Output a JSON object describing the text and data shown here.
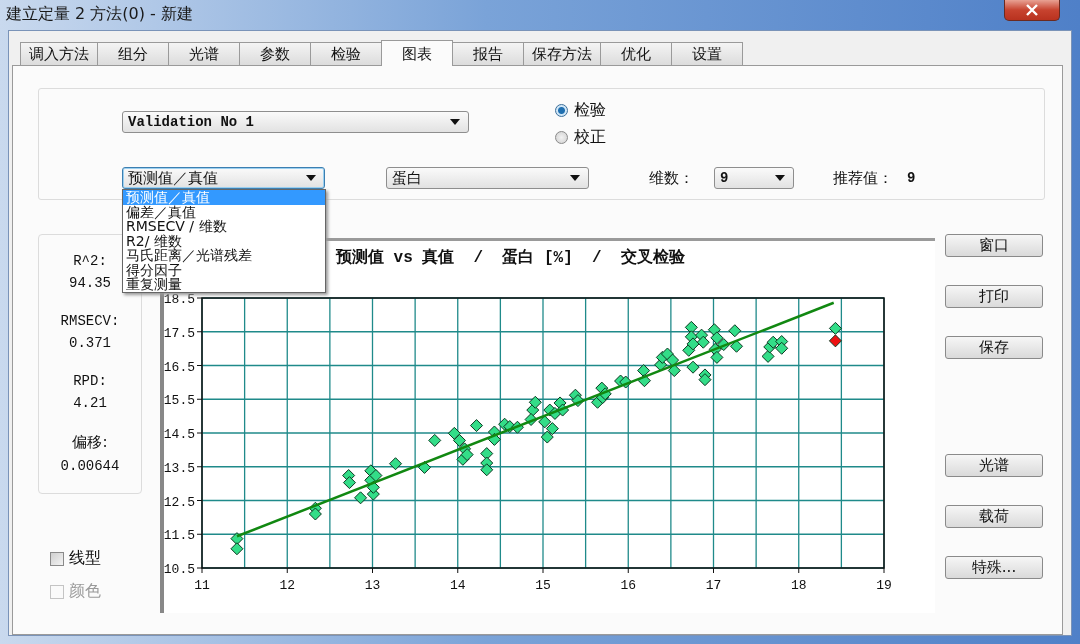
{
  "window": {
    "title": "建立定量 2 方法(0)  -  新建"
  },
  "tabs": [
    {
      "label": "调入方法",
      "selected": false
    },
    {
      "label": "组分",
      "selected": false
    },
    {
      "label": "光谱",
      "selected": false
    },
    {
      "label": "参数",
      "selected": false
    },
    {
      "label": "检验",
      "selected": false
    },
    {
      "label": "图表",
      "selected": true
    },
    {
      "label": "报告",
      "selected": false
    },
    {
      "label": "保存方法",
      "selected": false
    },
    {
      "label": "优化",
      "selected": false
    },
    {
      "label": "设置",
      "selected": false
    }
  ],
  "options": {
    "validation_set": {
      "value": "Validation No 1"
    },
    "radios": [
      {
        "label": "检验",
        "selected": true
      },
      {
        "label": "校正",
        "selected": false
      }
    ],
    "plot_type": {
      "value": "预测值／真值",
      "expanded": true,
      "items": [
        {
          "label": "预测值／真值",
          "selected": true
        },
        {
          "label": "偏差／真值",
          "selected": false
        },
        {
          "label": "RMSECV / 维数",
          "selected": false
        },
        {
          "label": "R2/ 维数",
          "selected": false
        },
        {
          "label": "马氏距离／光谱残差",
          "selected": false
        },
        {
          "label": "得分因子",
          "selected": false
        },
        {
          "label": "重复测量",
          "selected": false
        }
      ]
    },
    "component": {
      "value": "蛋白"
    },
    "factors": {
      "label": "维数：",
      "value": "9"
    },
    "recommended": {
      "label": "推荐值：",
      "value": "9"
    }
  },
  "stats": [
    {
      "label": "R^2:",
      "value": "94.35"
    },
    {
      "label": "RMSECV:",
      "value": "0.371"
    },
    {
      "label": "RPD:",
      "value": "4.21"
    },
    {
      "label": "偏移:",
      "value": "0.00644"
    }
  ],
  "checkboxes": [
    {
      "label": "线型",
      "checked": false,
      "disabled": false
    },
    {
      "label": "颜色",
      "checked": false,
      "disabled": true
    }
  ],
  "chart": {
    "title": "预测值 vs 真值  /  蛋白 [%]  /  交叉检验",
    "chart_data": {
      "type": "scatter",
      "grid": true,
      "xlim": [
        11,
        19
      ],
      "ylim": [
        10.5,
        18.5
      ],
      "xticks": [
        11,
        12,
        13,
        14,
        15,
        16,
        17,
        18,
        19
      ],
      "yticks": [
        10.5,
        11.5,
        12.5,
        13.5,
        14.5,
        15.5,
        16.5,
        17.5,
        18.5
      ],
      "series": [
        {
          "color": "#33dd88",
          "x": [
            11.41,
            11.41,
            12.33,
            12.33,
            12.72,
            12.73,
            12.86,
            12.98,
            12.98,
            13.01,
            13.04,
            13.01,
            13.27,
            13.61,
            13.73,
            13.96,
            14.02,
            14.08,
            14.06,
            14.11,
            14.22,
            14.34,
            14.34,
            14.34,
            14.43,
            14.43,
            14.55,
            14.61,
            14.7,
            14.88,
            14.91,
            14.86,
            15.02,
            15.05,
            15.11,
            15.08,
            15.14,
            15.2,
            15.23,
            15.38,
            15.41,
            15.64,
            15.7,
            15.69,
            15.73,
            15.91,
            15.97,
            16.18,
            16.19,
            16.38,
            16.4,
            16.46,
            16.52,
            16.54,
            16.71,
            16.74,
            16.74,
            16.76,
            16.76,
            16.86,
            16.88,
            16.9,
            16.9,
            17.01,
            17.04,
            17.02,
            17.04,
            17.12,
            17.25,
            17.27,
            17.64,
            17.66,
            17.7,
            17.8,
            17.8,
            18.43
          ],
          "values": [
            11.37,
            11.07,
            12.27,
            12.1,
            13.24,
            13.03,
            12.58,
            13.38,
            13.1,
            12.69,
            13.24,
            12.89,
            13.59,
            13.48,
            14.28,
            14.49,
            14.28,
            14.03,
            13.72,
            13.86,
            14.72,
            13.89,
            13.61,
            13.41,
            14.53,
            14.31,
            14.76,
            14.69,
            14.67,
            15.18,
            15.41,
            14.9,
            14.83,
            14.38,
            14.63,
            15.18,
            15.08,
            15.39,
            15.18,
            15.62,
            15.46,
            15.41,
            15.55,
            15.83,
            15.66,
            16.04,
            16.01,
            16.35,
            16.05,
            16.52,
            16.74,
            16.84,
            16.66,
            16.35,
            16.95,
            17.63,
            17.35,
            17.14,
            16.45,
            17.4,
            17.19,
            16.22,
            16.08,
            17.56,
            17.32,
            16.98,
            16.74,
            17.12,
            17.53,
            17.07,
            16.77,
            17.05,
            17.19,
            17.21,
            17.01,
            17.6
          ]
        },
        {
          "color": "#ee1111",
          "x": [
            18.43
          ],
          "values": [
            17.23
          ]
        },
        {
          "type": "line",
          "color": "#118811",
          "x": [
            11.41,
            18.41
          ],
          "values": [
            11.44,
            18.36
          ]
        }
      ]
    }
  },
  "buttons_top": [
    "窗口",
    "打印",
    "保存"
  ],
  "buttons_bottom": [
    "光谱",
    "载荷",
    "特殊..."
  ]
}
